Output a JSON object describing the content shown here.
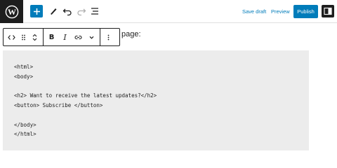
{
  "header": {
    "logo_icon": "wordpress-icon",
    "save_draft_label": "Save draft",
    "preview_label": "Preview",
    "publish_label": "Publish",
    "accent_color": "#007cba"
  },
  "block_toolbar": {
    "groups": [
      [
        "code-icon",
        "drag-handle-icon",
        "move-up-down-icon"
      ],
      [
        "bold-icon",
        "italic-icon",
        "link-icon",
        "chevron-down-icon"
      ],
      [
        "more-options-icon"
      ]
    ],
    "bold_label": "B",
    "italic_label": "I"
  },
  "paragraph": {
    "visible_text": "page:"
  },
  "code_block": {
    "lines": [
      "<html>",
      "<body>",
      "",
      "<h2> Want to receive the latest updates?</h2>",
      "<button> Subscribe </button>",
      "",
      "</body>",
      "</html>"
    ],
    "background": "#ececec"
  }
}
